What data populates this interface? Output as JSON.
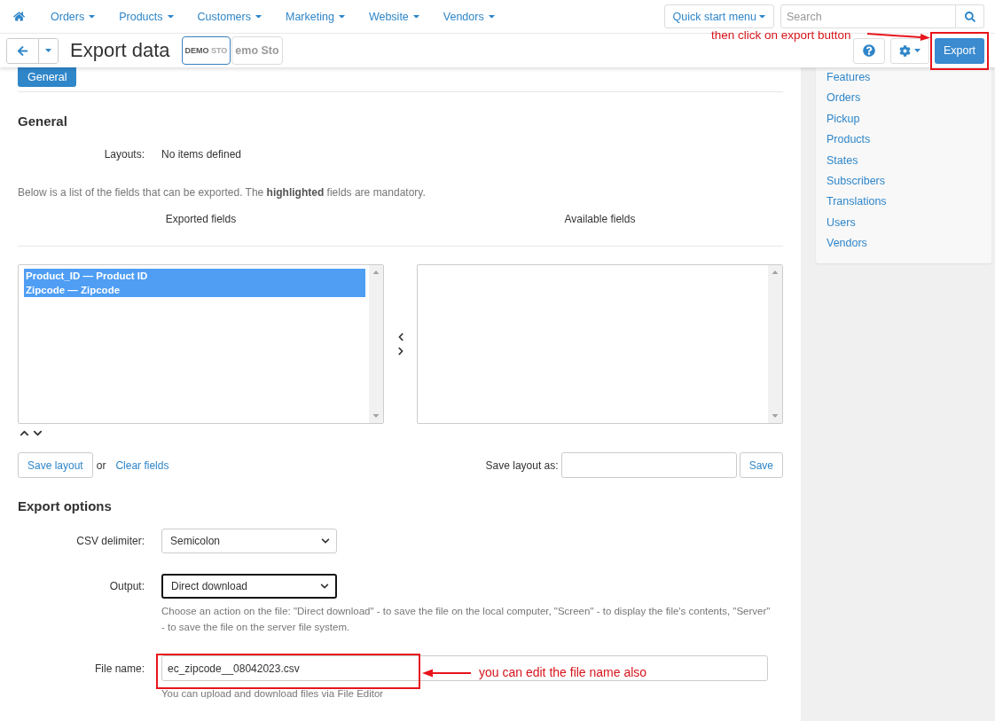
{
  "top_nav": {
    "items": [
      {
        "label": "Orders"
      },
      {
        "label": "Products"
      },
      {
        "label": "Customers"
      },
      {
        "label": "Marketing"
      },
      {
        "label": "Website"
      },
      {
        "label": "Vendors"
      }
    ],
    "quick_start": "Quick start menu",
    "search": {
      "placeholder": "Search"
    }
  },
  "header": {
    "title": "Export data",
    "storefronts": [
      {
        "label": "**DEMO** STO",
        "selected": true
      },
      {
        "label": "emo Sto",
        "selected": false
      }
    ],
    "export_button": "Export"
  },
  "tabs": [
    {
      "label": "General",
      "selected": true
    }
  ],
  "general": {
    "heading": "General",
    "layouts_label": "Layouts:",
    "layouts_value": "No items defined",
    "note": "Below is a list of the fields that can be exported. The **highlighted** fields are mandatory.",
    "exported": {
      "title": "Exported fields",
      "items": [
        {
          "label": "Product_ID — Product ID",
          "selected": true
        },
        {
          "label": "Zipcode — Zipcode",
          "selected": true
        }
      ]
    },
    "available": {
      "title": "Available fields"
    }
  },
  "layout_actions": {
    "save_layout": "Save layout",
    "or": "or",
    "clear_fields": "Clear fields",
    "save_as_label": "Save layout as:",
    "save": "Save"
  },
  "export_options": {
    "heading": "Export options",
    "fields": [
      {
        "kind": "select",
        "label": "CSV delimiter:",
        "value": "Semicolon",
        "focused": false
      },
      {
        "kind": "select",
        "label": "Output:",
        "value": "Direct download",
        "focused": true,
        "help": "Choose an action on the file: \"Direct download\" - to save the file on the local computer, \"Screen\" - to display the file's contents, \"Server\" - to save the file on the server file system."
      },
      {
        "kind": "text",
        "label": "File name:",
        "value": "ec_zipcode__08042023.csv",
        "focused": false,
        "help": "You can upload and download files via File Editor"
      }
    ]
  },
  "sidebar": {
    "items": [
      {
        "label": "Features"
      },
      {
        "label": "Orders"
      },
      {
        "label": "Pickup"
      },
      {
        "label": "Products"
      },
      {
        "label": "States"
      },
      {
        "label": "Subscribers"
      },
      {
        "label": "Translations"
      },
      {
        "label": "Users"
      },
      {
        "label": "Vendors"
      }
    ]
  },
  "annotations": [
    {
      "text": "then click on export button"
    },
    {
      "text": "you can edit the file name also"
    }
  ]
}
